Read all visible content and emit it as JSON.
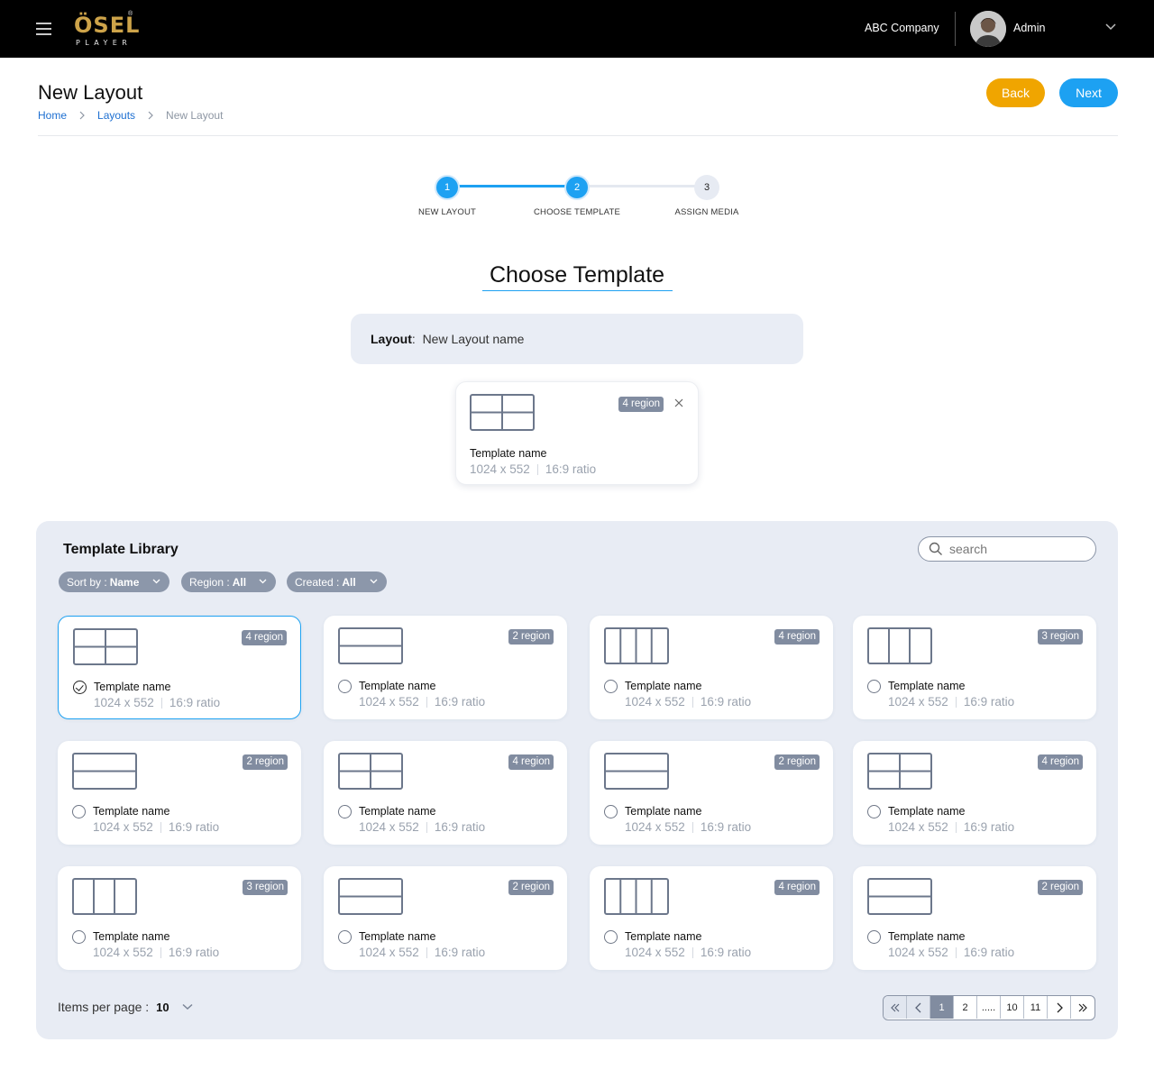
{
  "header": {
    "logo_main": "ÖSEL",
    "logo_sub": "PLAYER",
    "logo_reg": "®",
    "company": "ABC Company",
    "user": "Admin"
  },
  "page": {
    "title": "New Layout",
    "breadcrumb": [
      "Home",
      "Layouts",
      "New Layout"
    ],
    "back_label": "Back",
    "next_label": "Next"
  },
  "stepper": {
    "steps": [
      {
        "number": "1",
        "label": "NEW LAYOUT",
        "state": "completed"
      },
      {
        "number": "2",
        "label": "CHOOSE TEMPLATE",
        "state": "active"
      },
      {
        "number": "3",
        "label": "ASSIGN MEDIA",
        "state": "pending"
      }
    ]
  },
  "choose": {
    "title": "Choose Template",
    "layout_label": "Layout",
    "layout_value": "New Layout name"
  },
  "selected_template": {
    "name": "Template name",
    "size": "1024 x 552",
    "ratio": "16:9 ratio",
    "badge": "4 region",
    "preview": "quad"
  },
  "library": {
    "title": "Template Library",
    "search_placeholder": "search",
    "filters": [
      {
        "label": "Sort by :",
        "value": "Name"
      },
      {
        "label": "Region :",
        "value": "All"
      },
      {
        "label": "Created :",
        "value": "All"
      }
    ],
    "cards": [
      {
        "name": "Template name",
        "size": "1024 x 552",
        "ratio": "16:9 ratio",
        "badge": "4 region",
        "preview": "quad",
        "selected": true
      },
      {
        "name": "Template name",
        "size": "1024 x 552",
        "ratio": "16:9 ratio",
        "badge": "2 region",
        "preview": "hsplit",
        "selected": false
      },
      {
        "name": "Template name",
        "size": "1024 x 552",
        "ratio": "16:9 ratio",
        "badge": "4 region",
        "preview": "cols4",
        "selected": false
      },
      {
        "name": "Template name",
        "size": "1024 x 552",
        "ratio": "16:9 ratio",
        "badge": "3 region",
        "preview": "cols3",
        "selected": false
      },
      {
        "name": "Template name",
        "size": "1024 x 552",
        "ratio": "16:9 ratio",
        "badge": "2 region",
        "preview": "hsplit",
        "selected": false
      },
      {
        "name": "Template name",
        "size": "1024 x 552",
        "ratio": "16:9 ratio",
        "badge": "4 region",
        "preview": "quad",
        "selected": false
      },
      {
        "name": "Template name",
        "size": "1024 x 552",
        "ratio": "16:9 ratio",
        "badge": "2 region",
        "preview": "hsplit",
        "selected": false
      },
      {
        "name": "Template name",
        "size": "1024 x 552",
        "ratio": "16:9 ratio",
        "badge": "4 region",
        "preview": "quad",
        "selected": false
      },
      {
        "name": "Template name",
        "size": "1024 x 552",
        "ratio": "16:9 ratio",
        "badge": "3 region",
        "preview": "cols3",
        "selected": false
      },
      {
        "name": "Template name",
        "size": "1024 x 552",
        "ratio": "16:9 ratio",
        "badge": "2 region",
        "preview": "hsplit",
        "selected": false
      },
      {
        "name": "Template name",
        "size": "1024 x 552",
        "ratio": "16:9 ratio",
        "badge": "4 region",
        "preview": "cols4",
        "selected": false
      },
      {
        "name": "Template name",
        "size": "1024 x 552",
        "ratio": "16:9 ratio",
        "badge": "2 region",
        "preview": "hsplit",
        "selected": false
      }
    ],
    "items_per_page_label": "Items per page :",
    "items_per_page_value": "10",
    "pagination": [
      "1",
      "2",
      ".....",
      "10",
      "11"
    ],
    "current_page": "1"
  },
  "colors": {
    "accent": "#1da1f2",
    "back_button": "#f0a500",
    "badge": "#818ca0",
    "logo_gold": "#cda349",
    "panel": "#e8ecf4"
  }
}
